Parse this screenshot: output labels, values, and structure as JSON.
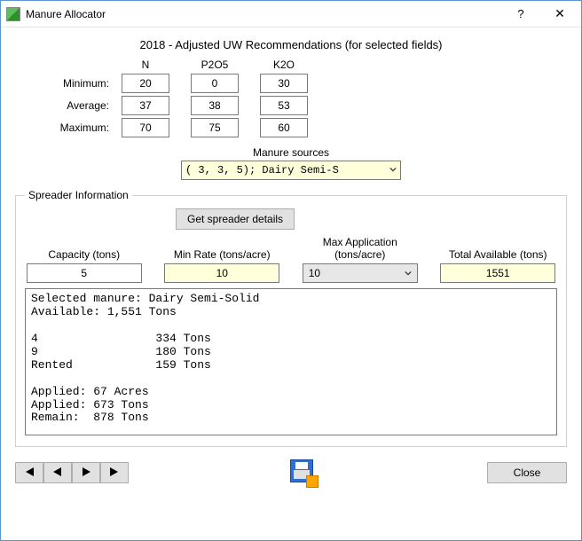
{
  "window": {
    "title": "Manure Allocator"
  },
  "heading": "2018 - Adjusted UW Recommendations  (for selected fields)",
  "reco": {
    "col_n": "N",
    "col_p": "P2O5",
    "col_k": "K2O",
    "min_label": "Minimum:",
    "avg_label": "Average:",
    "max_label": "Maximum:",
    "min": {
      "n": "20",
      "p": "0",
      "k": "30"
    },
    "avg": {
      "n": "37",
      "p": "38",
      "k": "53"
    },
    "max": {
      "n": "70",
      "p": "75",
      "k": "60"
    }
  },
  "manure_sources": {
    "label": "Manure sources",
    "selected": "(    3,    3,    5); Dairy Semi-S"
  },
  "spreader": {
    "legend": "Spreader Information",
    "get_btn": "Get spreader details",
    "capacity_label": "Capacity (tons)",
    "capacity_value": "5",
    "minrate_label": "Min Rate (tons/acre)",
    "minrate_value": "10",
    "maxapp_label": "Max Application (tons/acre)",
    "maxapp_value": "10",
    "total_label": "Total Available (tons)",
    "total_value": "1551"
  },
  "results_text": "Selected manure: Dairy Semi-Solid\nAvailable: 1,551 Tons\n\n4                 334 Tons\n9                 180 Tons\nRented            159 Tons\n\nApplied: 67 Acres\nApplied: 673 Tons\nRemain:  878 Tons",
  "bottom": {
    "close_label": "Close"
  }
}
